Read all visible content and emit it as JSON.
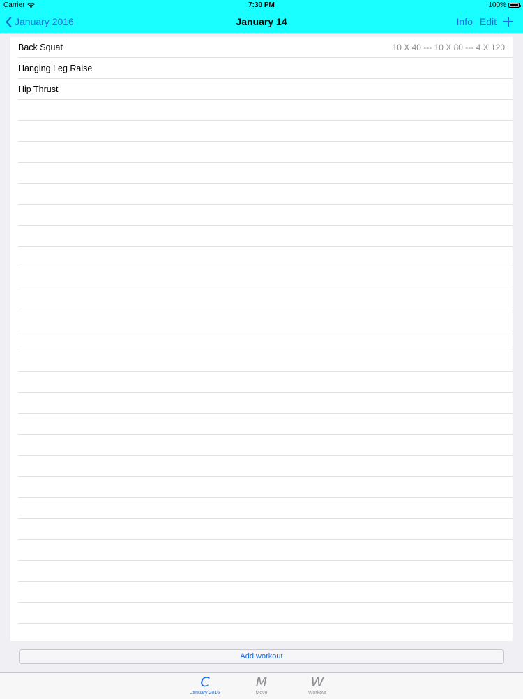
{
  "status_bar": {
    "carrier": "Carrier",
    "time": "7:30 PM",
    "battery": "100%"
  },
  "nav": {
    "back_label": "January 2016",
    "title": "January 14",
    "info_label": "Info",
    "edit_label": "Edit"
  },
  "rows": [
    {
      "title": "Back Squat",
      "detail": "10 X 40 --- 10 X 80 --- 4 X 120"
    },
    {
      "title": "Hanging Leg Raise",
      "detail": ""
    },
    {
      "title": "Hip Thrust",
      "detail": ""
    }
  ],
  "add_workout_label": "Add workout",
  "tabs": [
    {
      "icon": "C",
      "label": "January 2016",
      "active": true
    },
    {
      "icon": "M",
      "label": "Move",
      "active": false
    },
    {
      "icon": "W",
      "label": "Workout",
      "active": false
    }
  ],
  "colors": {
    "header_bg": "#19ffff",
    "accent": "#1a6ae6",
    "secondary_text": "#8e8e93"
  }
}
